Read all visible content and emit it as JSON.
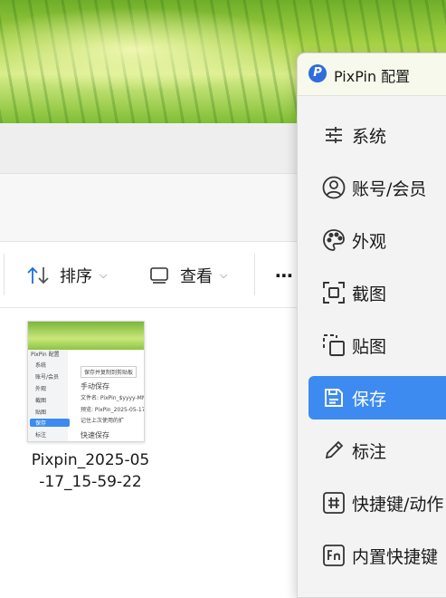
{
  "explorer": {
    "toolbar": {
      "sort_label": "排序",
      "view_label": "查看",
      "more_label": "⋯"
    },
    "file": {
      "name": "Pixpin_2025-05-17_15-59-22",
      "name_line1": "Pixpin_2025-05",
      "name_line2": "-17_15-59-22",
      "thumb": {
        "title": "PixPin 配置",
        "side_items": [
          "系统",
          "账号/会员",
          "外观",
          "截图",
          "贴图",
          "保存",
          "标注"
        ],
        "panel_header": "保存并复制到剪贴板",
        "section_manual": "手动保存",
        "row1": "文件名:   PixPin_$yyyy-MM-dd",
        "row2": "预览:      PixPin_2025-05-17_1",
        "row3": "记住上次使用的扩",
        "section_quick": "快速保存"
      }
    }
  },
  "pixpin": {
    "title": "PixPin 配置",
    "logo": "P",
    "items": [
      {
        "label": "系统",
        "icon": "sliders-icon"
      },
      {
        "label": "账号/会员",
        "icon": "user-circle-icon"
      },
      {
        "label": "外观",
        "icon": "palette-icon"
      },
      {
        "label": "截图",
        "icon": "screenshot-icon"
      },
      {
        "label": "贴图",
        "icon": "pin-image-icon"
      },
      {
        "label": "保存",
        "icon": "save-icon",
        "active": true
      },
      {
        "label": "标注",
        "icon": "pencil-icon"
      },
      {
        "label": "快捷键/动作",
        "icon": "hash-icon"
      },
      {
        "label": "内置快捷键",
        "icon": "fn-key-icon"
      }
    ],
    "accent": "#3d8bf0"
  }
}
